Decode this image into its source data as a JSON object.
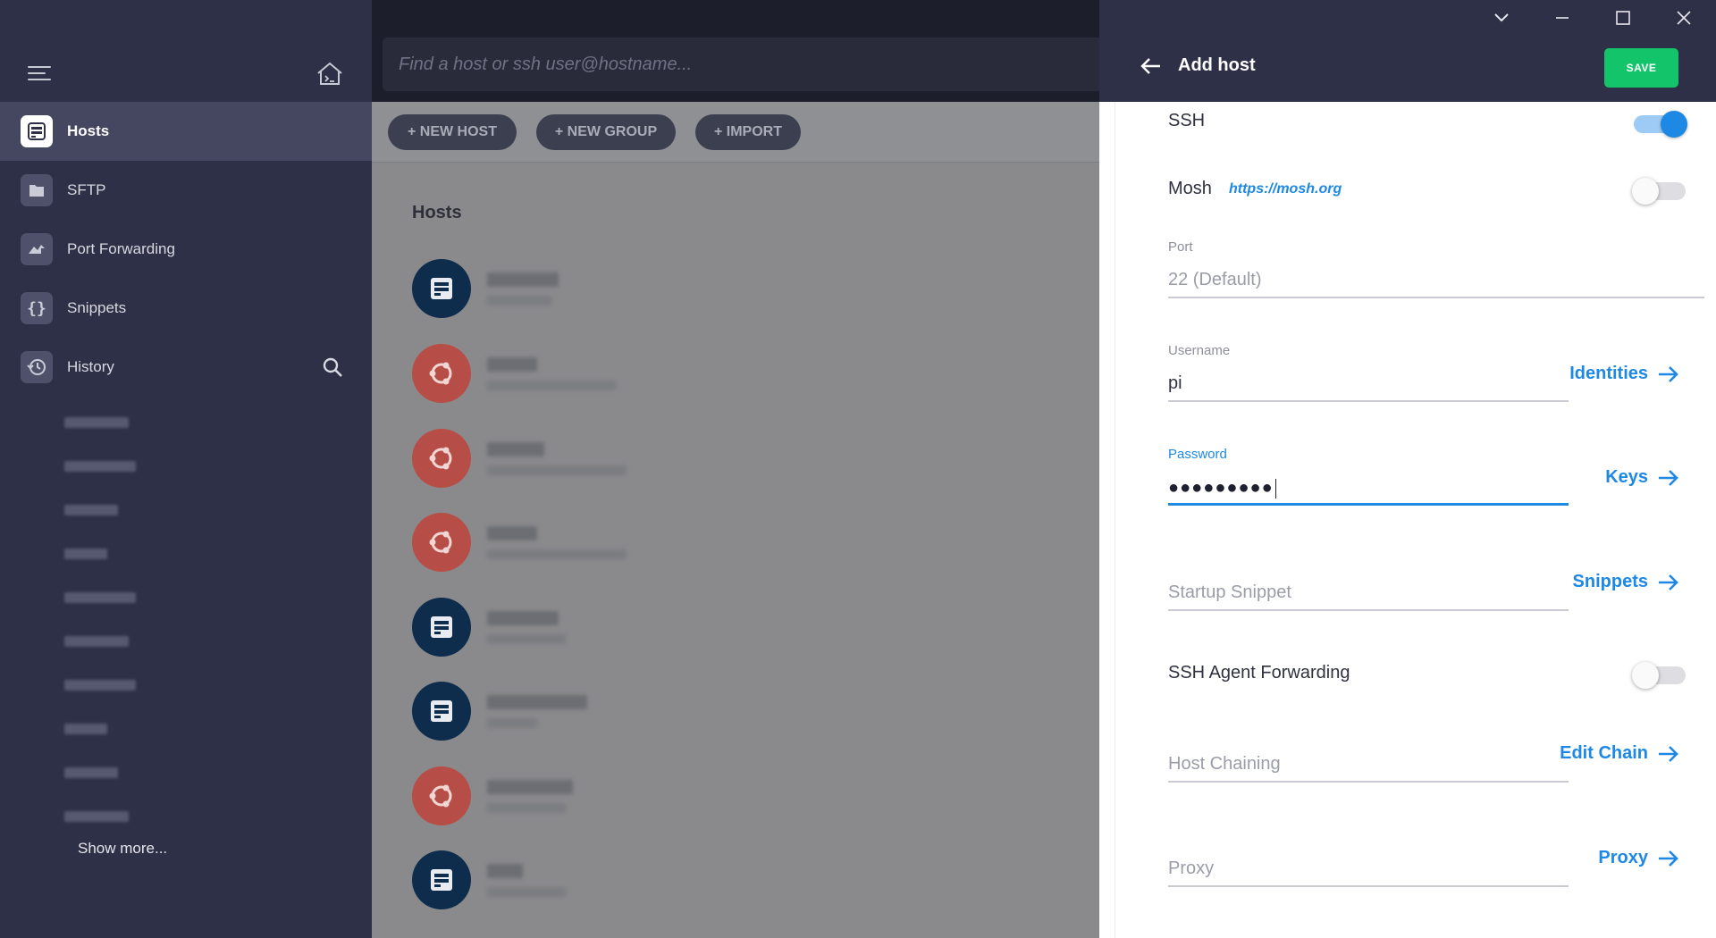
{
  "sidebar": {
    "items": [
      {
        "label": "Hosts",
        "icon": "hosts-icon"
      },
      {
        "label": "SFTP",
        "icon": "folder-icon"
      },
      {
        "label": "Port Forwarding",
        "icon": "port-forwarding-icon"
      },
      {
        "label": "Snippets",
        "icon": "braces-icon"
      },
      {
        "label": "History",
        "icon": "history-icon"
      }
    ],
    "show_more": "Show more..."
  },
  "search": {
    "placeholder": "Find a host or ssh user@hostname..."
  },
  "toolbar": {
    "new_host": "+ NEW HOST",
    "new_group": "+ NEW GROUP",
    "import": "+ IMPORT"
  },
  "hosts_section": {
    "title": "Hosts"
  },
  "panel": {
    "title": "Add host",
    "save": "SAVE",
    "ssh_label": "SSH",
    "ssh_enabled": true,
    "mosh_label": "Mosh",
    "mosh_link": "https://mosh.org",
    "mosh_enabled": false,
    "port_label": "Port",
    "port_placeholder": "22 (Default)",
    "username_label": "Username",
    "username_value": "pi",
    "identities_link": "Identities",
    "password_label": "Password",
    "password_mask": "●●●●●●●●●",
    "keys_link": "Keys",
    "startup_snippet_placeholder": "Startup Snippet",
    "snippets_link": "Snippets",
    "agent_forwarding_label": "SSH Agent Forwarding",
    "agent_forwarding_enabled": false,
    "host_chaining_placeholder": "Host Chaining",
    "edit_chain_link": "Edit Chain",
    "proxy_placeholder": "Proxy",
    "proxy_link": "Proxy"
  },
  "colors": {
    "sidebar_bg": "#2e3047",
    "accent_blue": "#1e88e5",
    "save_green": "#13c46b",
    "server_avatar": "#0e2c4b",
    "ubuntu_avatar": "#b64e47"
  }
}
